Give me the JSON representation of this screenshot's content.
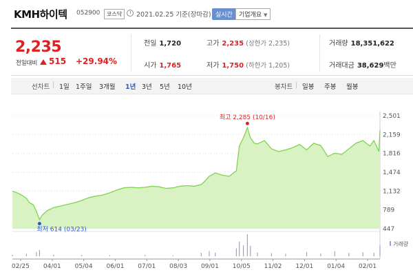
{
  "header": {
    "name": "KMH하이텍",
    "code": "052900",
    "market": "코스닥",
    "date": "2021.02.25 기준(장마감)",
    "realtime_button": "실시간",
    "company_button": "기업개요"
  },
  "quote": {
    "price": "2,235",
    "change_label": "전일대비",
    "change": "515",
    "change_pct": "+29.94%",
    "prev_label": "전일",
    "prev_value": "1,720",
    "open_label": "시가",
    "open_value": "1,765",
    "high_label": "고가",
    "high_value": "2,235",
    "upper_limit": "(상한가 2,235)",
    "low_label": "저가",
    "low_value": "1,750",
    "lower_limit": "(하한가 1,205)",
    "volume_label": "거래량",
    "volume_value": "18,351,622",
    "amount_label": "거래대금",
    "amount_value": "38,629",
    "amount_unit": "백만"
  },
  "period_bar": {
    "line_label": "선차트",
    "periods": [
      "1일",
      "1주일",
      "3개월",
      "1년",
      "3년",
      "5년",
      "10년"
    ],
    "active_period": "1년",
    "candle_label": "봉차트",
    "candles": [
      "일봉",
      "주봉",
      "월봉"
    ]
  },
  "colors": {
    "up": "#e02020",
    "accent": "#2a5cc9",
    "line": "#7fd24f",
    "fill": "#d9f2c4",
    "volume": "#9aa3cf"
  },
  "chart_data": {
    "type": "area",
    "title": "",
    "xlabel": "",
    "ylabel": "",
    "x_ticks": [
      "02/25",
      "04/01",
      "05/04",
      "06/01",
      "07/01",
      "08/03",
      "09/01",
      "10/05",
      "11/02",
      "12/01",
      "01/04",
      "02/01"
    ],
    "y_ticks": [
      447,
      789,
      1132,
      1474,
      1816,
      2159,
      2501
    ],
    "ylim": [
      447,
      2501
    ],
    "grid": true,
    "max_annotation": "최고 2,285 (10/16)",
    "min_annotation": "최저 614 (03/23)",
    "volume_legend": "거래량",
    "series": [
      {
        "x": [
          "2020-02-25",
          "2020-03-02",
          "2020-03-06",
          "2020-03-10",
          "2020-03-13",
          "2020-03-17",
          "2020-03-20",
          "2020-03-23",
          "2020-03-26",
          "2020-03-31",
          "2020-04-06",
          "2020-04-13",
          "2020-04-20",
          "2020-04-27",
          "2020-05-04",
          "2020-05-11",
          "2020-05-18",
          "2020-05-25",
          "2020-06-01",
          "2020-06-08",
          "2020-06-15",
          "2020-06-22",
          "2020-06-29",
          "2020-07-06",
          "2020-07-13",
          "2020-07-20",
          "2020-07-27",
          "2020-08-03",
          "2020-08-10",
          "2020-08-17",
          "2020-08-24",
          "2020-08-31",
          "2020-09-03",
          "2020-09-08",
          "2020-09-14",
          "2020-09-21",
          "2020-09-28",
          "2020-10-05",
          "2020-10-08",
          "2020-10-12",
          "2020-10-16",
          "2020-10-19",
          "2020-10-23",
          "2020-10-26",
          "2020-11-02",
          "2020-11-09",
          "2020-11-16",
          "2020-11-23",
          "2020-11-30",
          "2020-12-07",
          "2020-12-14",
          "2020-12-21",
          "2020-12-28",
          "2021-01-04",
          "2021-01-11",
          "2021-01-18",
          "2021-01-25",
          "2021-02-01",
          "2021-02-08",
          "2021-02-15",
          "2021-02-19",
          "2021-02-24",
          "2021-02-25"
        ],
        "values": [
          1132,
          1090,
          1050,
          1000,
          920,
          880,
          760,
          614,
          700,
          780,
          830,
          860,
          890,
          920,
          960,
          1010,
          1040,
          1060,
          1100,
          1150,
          1190,
          1200,
          1190,
          1200,
          1220,
          1210,
          1180,
          1190,
          1220,
          1230,
          1220,
          1250,
          1300,
          1400,
          1460,
          1420,
          1400,
          1500,
          1950,
          2100,
          2285,
          2100,
          2000,
          1990,
          2050,
          1900,
          1850,
          1880,
          1920,
          1980,
          1880,
          2000,
          1960,
          1760,
          1820,
          1800,
          1900,
          2000,
          2050,
          1950,
          2050,
          1850,
          2235
        ]
      },
      {
        "name": "거래량",
        "x": [
          "2020-02-25",
          "2020-03-10",
          "2020-03-20",
          "2020-03-23",
          "2020-04-06",
          "2020-05-04",
          "2020-06-01",
          "2020-07-06",
          "2020-08-03",
          "2020-08-31",
          "2020-09-08",
          "2020-09-14",
          "2020-10-05",
          "2020-10-08",
          "2020-10-12",
          "2020-10-16",
          "2020-10-19",
          "2020-10-26",
          "2020-11-09",
          "2020-11-23",
          "2020-12-14",
          "2020-12-28",
          "2021-01-11",
          "2021-01-25",
          "2021-02-08",
          "2021-02-19",
          "2021-02-25"
        ],
        "values": [
          1.2,
          2.0,
          3.5,
          5.2,
          1.4,
          1.1,
          0.9,
          1.0,
          0.8,
          2.8,
          4.2,
          3.0,
          6.5,
          12.0,
          9.0,
          18.0,
          8.5,
          3.0,
          2.5,
          2.0,
          3.5,
          2.2,
          4.0,
          2.6,
          3.2,
          2.8,
          9.0
        ]
      }
    ]
  }
}
